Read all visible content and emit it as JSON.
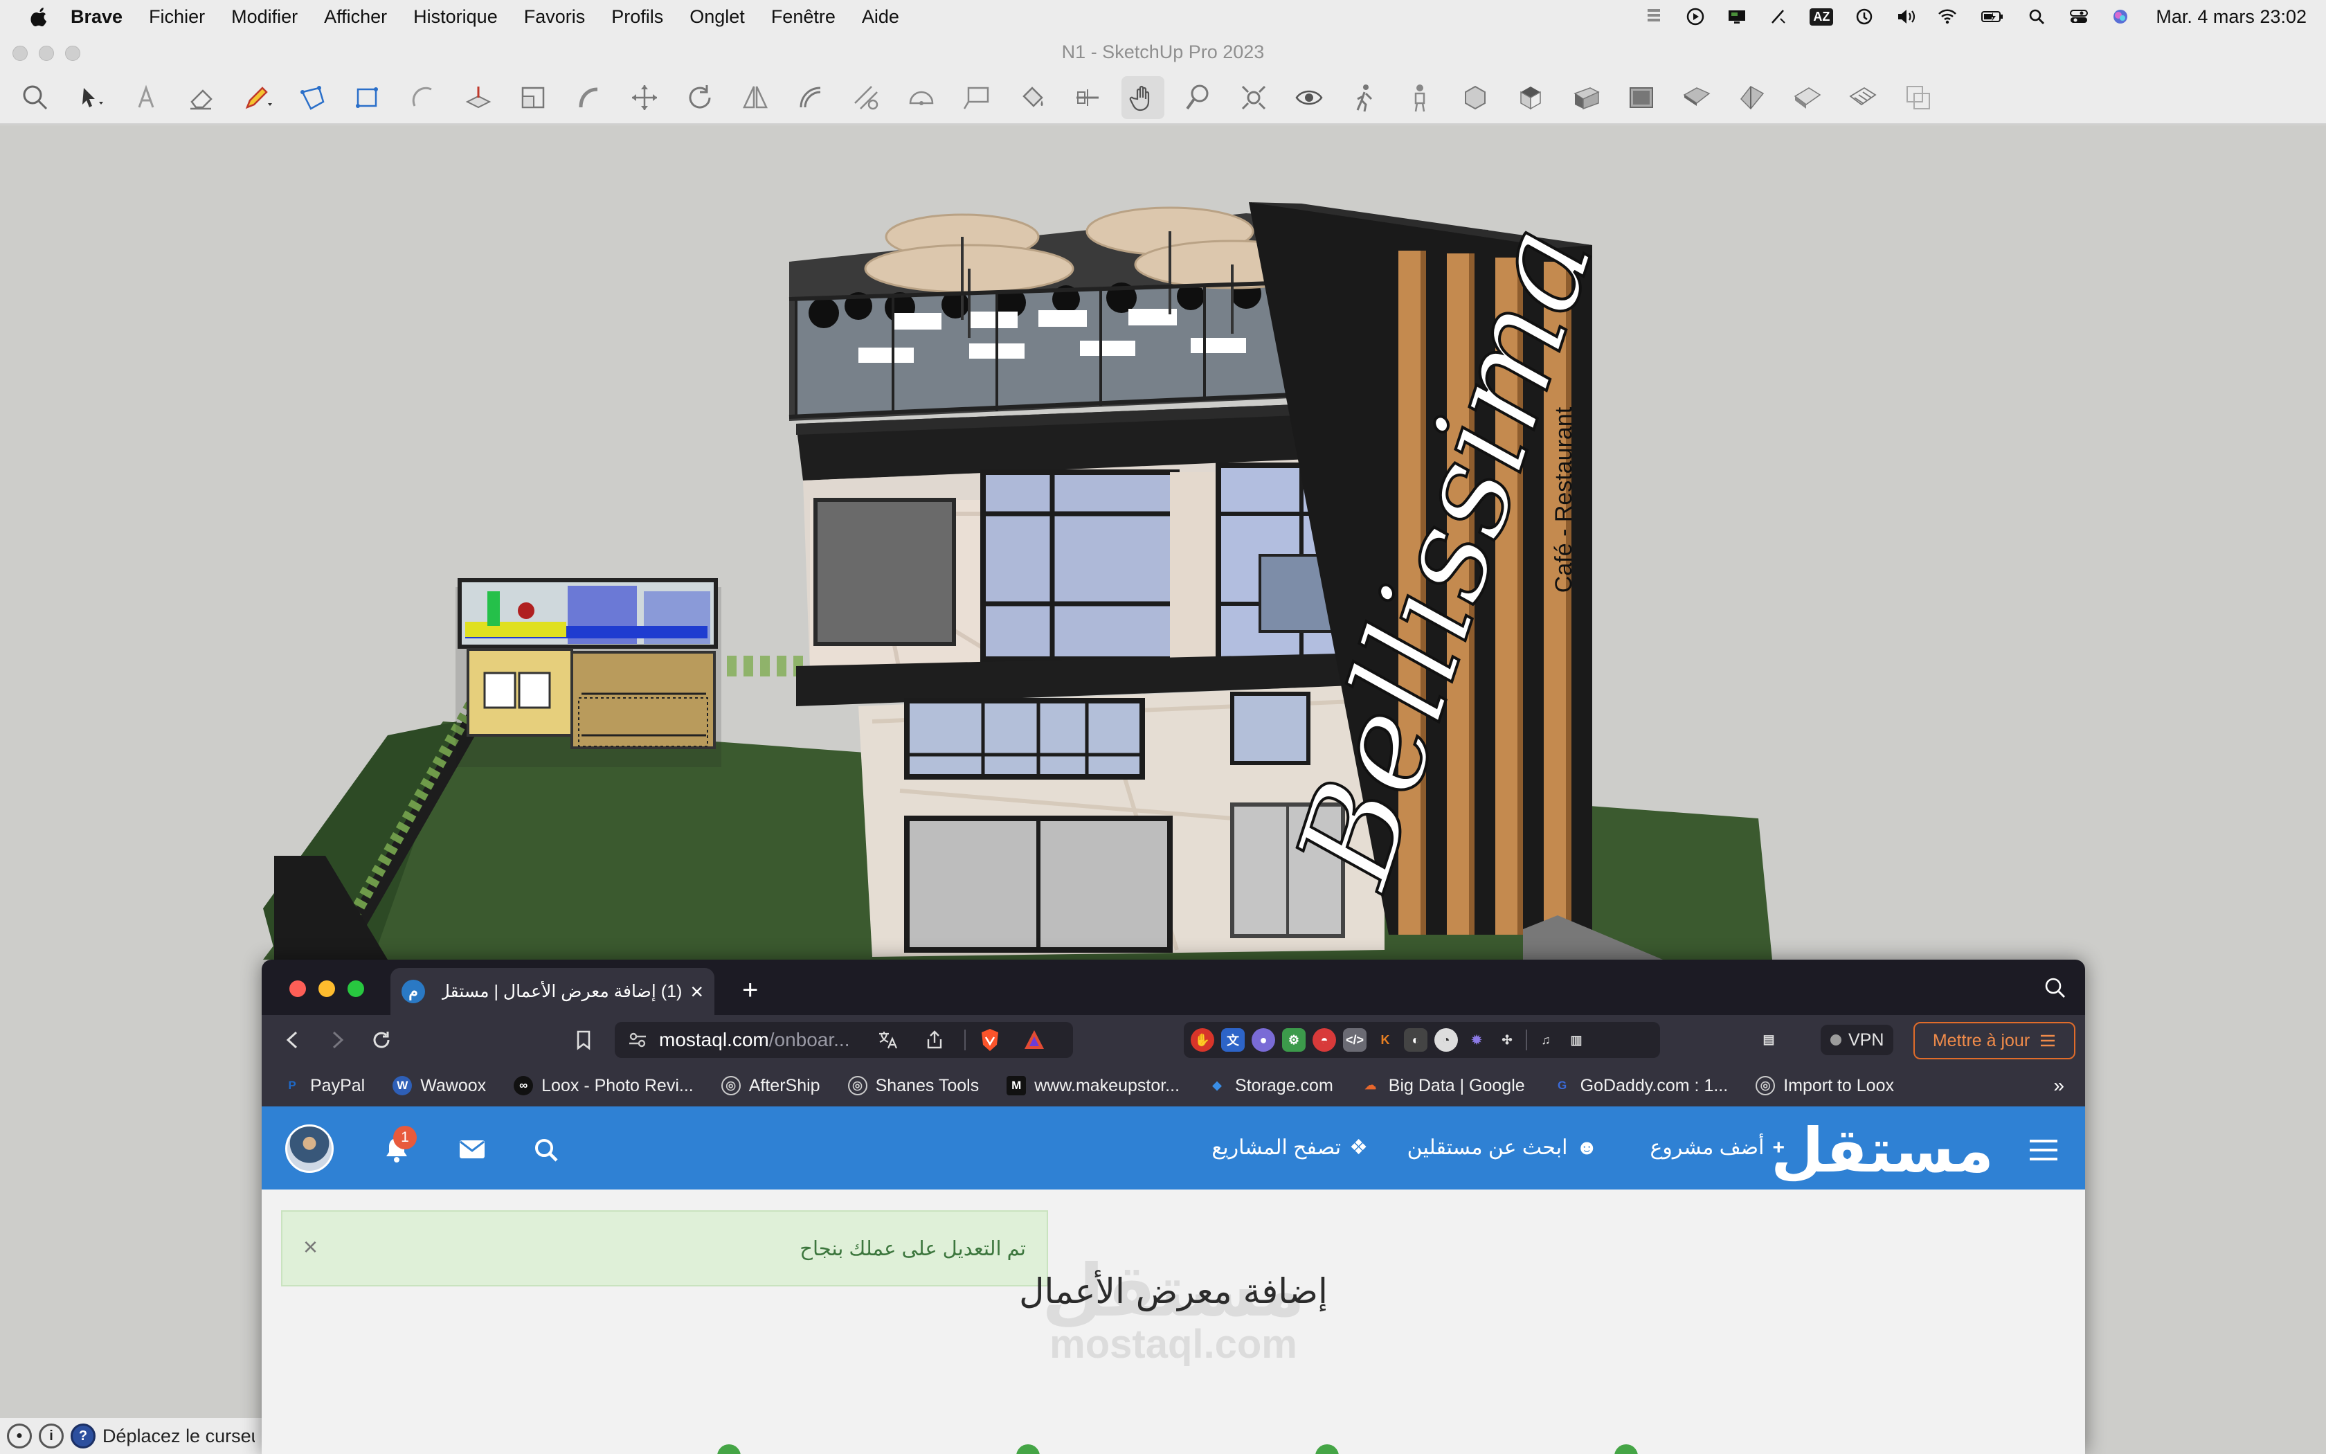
{
  "menubar": {
    "app_name": "Brave",
    "items": [
      "Fichier",
      "Modifier",
      "Afficher",
      "Historique",
      "Favoris",
      "Profils",
      "Onglet",
      "Fenêtre",
      "Aide"
    ],
    "input_source": "AZ",
    "clock": "Mar. 4 mars  23:02"
  },
  "sketchup": {
    "window_title": "N1 - SketchUp Pro 2023",
    "tools": [
      "search",
      "select",
      "eraser-text",
      "eraser",
      "pencil",
      "polygon",
      "rectangle",
      "arc",
      "push-pull",
      "scale",
      "follow-me",
      "move",
      "rotate",
      "flip",
      "offset",
      "tape",
      "protractor",
      "text",
      "paint",
      "section",
      "pan",
      "zoom",
      "zoom-extents",
      "look-around",
      "walk",
      "position-camera",
      "iso-view",
      "top-view",
      "front-view",
      "right-view",
      "back-view",
      "left-view",
      "bottom-view",
      "wireframe",
      "xray",
      "shaded"
    ],
    "active_tool": "pan",
    "model": {
      "sign_text": "Bellissima",
      "sign_subtext": "Café - Restaurant"
    },
    "status_text": "Déplacez le curseur"
  },
  "brave": {
    "tab": {
      "title": "(1) إضافة معرض الأعمال | مستقل",
      "favicon": "mostaql-icon"
    },
    "url": {
      "host": "mostaql.com",
      "path": "/onboar..."
    },
    "vpn_label": "VPN",
    "update_label": "Mettre à jour",
    "bookmarks": [
      {
        "label": "PayPal",
        "icon": "P",
        "color": "#1f69c6"
      },
      {
        "label": "Wawoox",
        "icon": "W",
        "color": "#2e5fb7"
      },
      {
        "label": "Loox - Photo Revi...",
        "icon": "∞",
        "color": "#111111"
      },
      {
        "label": "AfterShip",
        "icon": "◎",
        "color": "#5d5d66"
      },
      {
        "label": "Shanes Tools",
        "icon": "◎",
        "color": "#5d5d66"
      },
      {
        "label": "www.makeupstor...",
        "icon": "M",
        "color": "#111111"
      },
      {
        "label": "Storage.com",
        "icon": "◆",
        "color": "#3a8ee6"
      },
      {
        "label": "Big Data | Google",
        "icon": "☁",
        "color": "#e8672c"
      },
      {
        "label": "GoDaddy.com : 1...",
        "icon": "G",
        "color": "#3a6ad8"
      },
      {
        "label": "Import to Loox",
        "icon": "◎",
        "color": "#5d5d66"
      }
    ],
    "bookmarks_more": "»"
  },
  "site": {
    "logo": "مستقل",
    "nav": {
      "add_project": "أضف مشروع",
      "find_freelancers": "ابحث عن مستقلين",
      "browse_projects": "تصفح المشاريع"
    },
    "notifications_count": "1",
    "alert_text": "تم التعديل على عملك بنجاح",
    "alert_close": "×",
    "watermark_ar": "مستقل",
    "watermark_en": "mostaql.com",
    "page_title": "إضافة معرض الأعمال"
  },
  "colors": {
    "mostaql_blue": "#2f81d4",
    "alert_bg": "#dff0d8",
    "brave_dark": "#1c1b24",
    "update_orange": "#e06c2a"
  }
}
